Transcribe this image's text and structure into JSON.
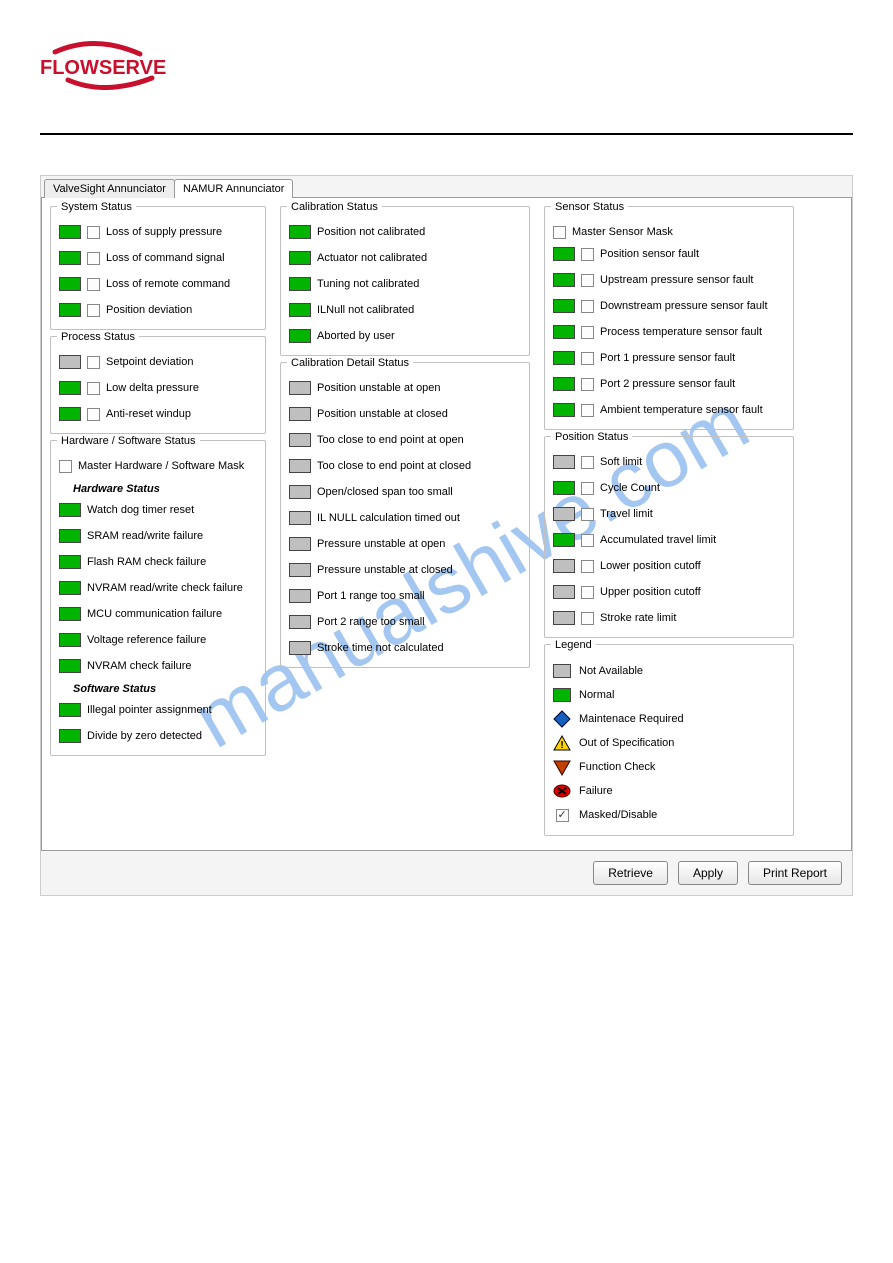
{
  "brand": "FLOWSERVE",
  "watermark": "manualshive.com",
  "tabs": {
    "inactive": "ValveSight Annunciator",
    "active": "NAMUR Annunciator"
  },
  "buttons": {
    "retrieve": "Retrieve",
    "apply": "Apply",
    "print": "Print Report"
  },
  "col1": {
    "system_status": {
      "title": "System Status",
      "items": [
        {
          "label": "Loss of supply pressure",
          "status": "green",
          "checkbox": true,
          "checked": false
        },
        {
          "label": "Loss of command signal",
          "status": "green",
          "checkbox": true,
          "checked": false
        },
        {
          "label": "Loss of remote command",
          "status": "green",
          "checkbox": true,
          "checked": false
        },
        {
          "label": "Position deviation",
          "status": "green",
          "checkbox": true,
          "checked": false
        }
      ]
    },
    "process_status": {
      "title": "Process Status",
      "items": [
        {
          "label": "Setpoint deviation",
          "status": "gray",
          "checkbox": true,
          "checked": false
        },
        {
          "label": "Low delta pressure",
          "status": "green",
          "checkbox": true,
          "checked": false
        },
        {
          "label": "Anti-reset windup",
          "status": "green",
          "checkbox": true,
          "checked": false
        }
      ]
    },
    "hw_sw_status": {
      "title": "Hardware / Software Status",
      "master_label": "Master Hardware / Software Mask",
      "hw_head": "Hardware Status",
      "hw_items": [
        {
          "label": "Watch dog timer reset",
          "status": "green"
        },
        {
          "label": "SRAM read/write failure",
          "status": "green"
        },
        {
          "label": "Flash RAM check failure",
          "status": "green"
        },
        {
          "label": "NVRAM read/write check failure",
          "status": "green"
        },
        {
          "label": "MCU communication failure",
          "status": "green"
        },
        {
          "label": "Voltage reference failure",
          "status": "green"
        },
        {
          "label": "NVRAM check failure",
          "status": "green"
        }
      ],
      "sw_head": "Software Status",
      "sw_items": [
        {
          "label": "Illegal pointer assignment",
          "status": "green"
        },
        {
          "label": "Divide by zero detected",
          "status": "green"
        }
      ]
    }
  },
  "col2": {
    "calibration_status": {
      "title": "Calibration Status",
      "items": [
        {
          "label": "Position not calibrated",
          "status": "green"
        },
        {
          "label": "Actuator not calibrated",
          "status": "green"
        },
        {
          "label": "Tuning not calibrated",
          "status": "green"
        },
        {
          "label": "ILNull not calibrated",
          "status": "green"
        },
        {
          "label": "Aborted by user",
          "status": "green"
        }
      ]
    },
    "calibration_detail": {
      "title": "Calibration Detail Status",
      "items": [
        {
          "label": "Position unstable at open",
          "status": "gray"
        },
        {
          "label": "Position unstable at closed",
          "status": "gray"
        },
        {
          "label": "Too close to end point at open",
          "status": "gray"
        },
        {
          "label": "Too close to end point at closed",
          "status": "gray"
        },
        {
          "label": "Open/closed span too small",
          "status": "gray"
        },
        {
          "label": "IL NULL calculation timed out",
          "status": "gray"
        },
        {
          "label": "Pressure unstable at open",
          "status": "gray"
        },
        {
          "label": "Pressure unstable at closed",
          "status": "gray"
        },
        {
          "label": "Port 1 range too small",
          "status": "gray"
        },
        {
          "label": "Port 2 range too small",
          "status": "gray"
        },
        {
          "label": "Stroke time not calculated",
          "status": "gray"
        }
      ]
    }
  },
  "col3": {
    "sensor_status": {
      "title": "Sensor Status",
      "master_label": "Master Sensor Mask",
      "items": [
        {
          "label": "Position sensor fault",
          "status": "green",
          "checkbox": true
        },
        {
          "label": "Upstream pressure sensor fault",
          "status": "green",
          "checkbox": true
        },
        {
          "label": "Downstream pressure sensor fault",
          "status": "green",
          "checkbox": true
        },
        {
          "label": "Process temperature sensor fault",
          "status": "green",
          "checkbox": true
        },
        {
          "label": "Port 1 pressure sensor fault",
          "status": "green",
          "checkbox": true
        },
        {
          "label": "Port 2 pressure sensor fault",
          "status": "green",
          "checkbox": true
        },
        {
          "label": "Ambient temperature sensor fault",
          "status": "green",
          "checkbox": true
        }
      ]
    },
    "position_status": {
      "title": "Position Status",
      "items": [
        {
          "label": "Soft limit",
          "status": "gray",
          "checkbox": true
        },
        {
          "label": "Cycle Count",
          "status": "green",
          "checkbox": true
        },
        {
          "label": "Travel limit",
          "status": "gray",
          "checkbox": true
        },
        {
          "label": "Accumulated travel limit",
          "status": "green",
          "checkbox": true
        },
        {
          "label": "Lower position cutoff",
          "status": "gray",
          "checkbox": true
        },
        {
          "label": "Upper position cutoff",
          "status": "gray",
          "checkbox": true
        },
        {
          "label": "Stroke rate limit",
          "status": "gray",
          "checkbox": true
        }
      ]
    },
    "legend": {
      "title": "Legend",
      "items": [
        {
          "kind": "swatch-gray",
          "label": "Not Available"
        },
        {
          "kind": "swatch-green",
          "label": "Normal"
        },
        {
          "kind": "diamond-blue",
          "label": "Maintenace Required"
        },
        {
          "kind": "triangle-yel",
          "label": "Out of Specification"
        },
        {
          "kind": "triangle-down",
          "label": "Function Check"
        },
        {
          "kind": "circle-red",
          "label": "Failure"
        },
        {
          "kind": "checkbox",
          "label": "Masked/Disable"
        }
      ]
    }
  }
}
